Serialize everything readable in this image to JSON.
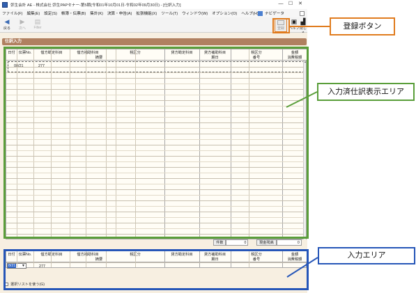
{
  "window": {
    "title": "弥生会計 AE - 株式会社 弥生PAPセナー-第5期(令和01年10月01日-令和02年09月30日) - [仕訳入力]",
    "controls": [
      "—",
      "☐",
      "✕"
    ]
  },
  "menu": [
    "ファイル(F)",
    "編集(E)",
    "設定(S)",
    "帳簿・伝票(B)",
    "集計(K)",
    "決算・申告(A)",
    "拡張機能(X)",
    "ツール(T)",
    "ウィンドウ(W)",
    "オプション(O)",
    "ヘルプ(H)"
  ],
  "navi_label": "ナビゲータ",
  "toolbar": {
    "back": "戻る",
    "forward": "次へ",
    "filter": "Filter",
    "register": "登録",
    "help": "ヘルプ",
    "close": "閉じる"
  },
  "section_title": "仕訳入力",
  "upper_table": {
    "header_top": [
      "日付",
      "伝票No.",
      "借方勘定科目",
      "借方補助科目",
      "税区分",
      "貸方勘定科目",
      "貸方補助科目",
      "税区分",
      "金額"
    ],
    "header_bottom": [
      "摘要",
      "期日",
      "番号",
      "消費税額"
    ],
    "first_row": {
      "date": "08/21",
      "slip_no": "277"
    },
    "summary": {
      "count_label": "件数",
      "count_value": "0",
      "balance_label": "現金残高",
      "balance_value": "0"
    }
  },
  "lower_table": {
    "header_top": [
      "日付",
      "伝票No.",
      "借方勘定科目",
      "借方補助科目",
      "税区分",
      "貸方勘定科目",
      "貸方補助科目",
      "税区分",
      "金額"
    ],
    "header_bottom": [
      "摘要",
      "期日",
      "番号",
      "消費税額"
    ],
    "date_value": "8/21",
    "slip_no": "277",
    "list_option": "選択リストを使う(G)"
  },
  "annotations": {
    "register_button": "登録ボタン",
    "upper_area": "入力済仕訳表示エリア",
    "lower_area": "入力エリア"
  },
  "colors": {
    "register_frame": "#e07b1d",
    "upper_frame": "#5a9e3a",
    "lower_frame": "#2656b8",
    "section_tab": "#b08060"
  }
}
